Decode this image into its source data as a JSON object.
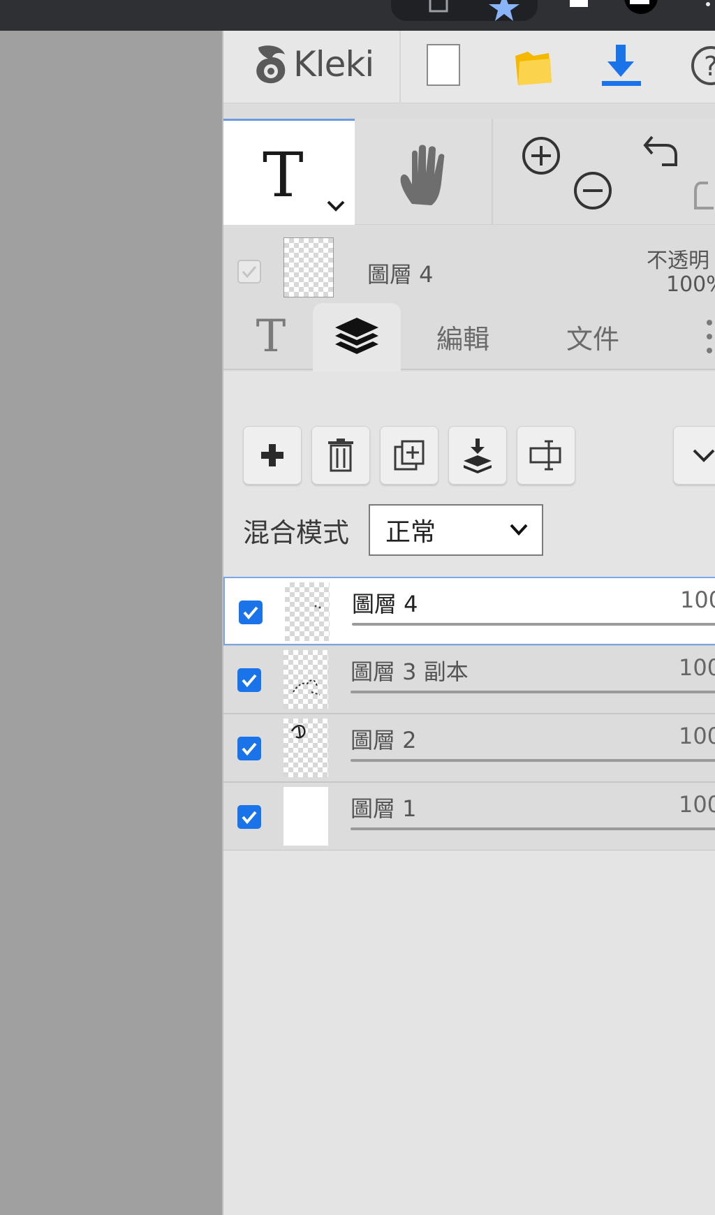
{
  "app": {
    "name": "Kleki"
  },
  "toolbar": {
    "new_label": "New",
    "open_label": "Open",
    "download_label": "Download",
    "help_label": "?"
  },
  "tools": {
    "text_tool": "T",
    "hand_tool": "hand"
  },
  "current_layer": {
    "name": "圖層 4",
    "opacity_label": "不透明",
    "opacity_value": "100%"
  },
  "tabs": [
    {
      "label": "T",
      "icon": "text-icon"
    },
    {
      "label": "",
      "icon": "layers-icon"
    },
    {
      "label": "編輯"
    },
    {
      "label": "文件"
    }
  ],
  "blend": {
    "label": "混合模式",
    "value": "正常"
  },
  "layers": [
    {
      "name": "圖層 4",
      "opacity": "100",
      "visible": true,
      "selected": true
    },
    {
      "name": "圖層 3 副本",
      "opacity": "100",
      "visible": true,
      "selected": false
    },
    {
      "name": "圖層 2",
      "opacity": "100",
      "visible": true,
      "selected": false
    },
    {
      "name": "圖層 1",
      "opacity": "100",
      "visible": true,
      "selected": false
    }
  ],
  "colors": {
    "accent": "#1a73e8",
    "selected_border": "#7ba6e6",
    "download": "#1a73e8"
  }
}
